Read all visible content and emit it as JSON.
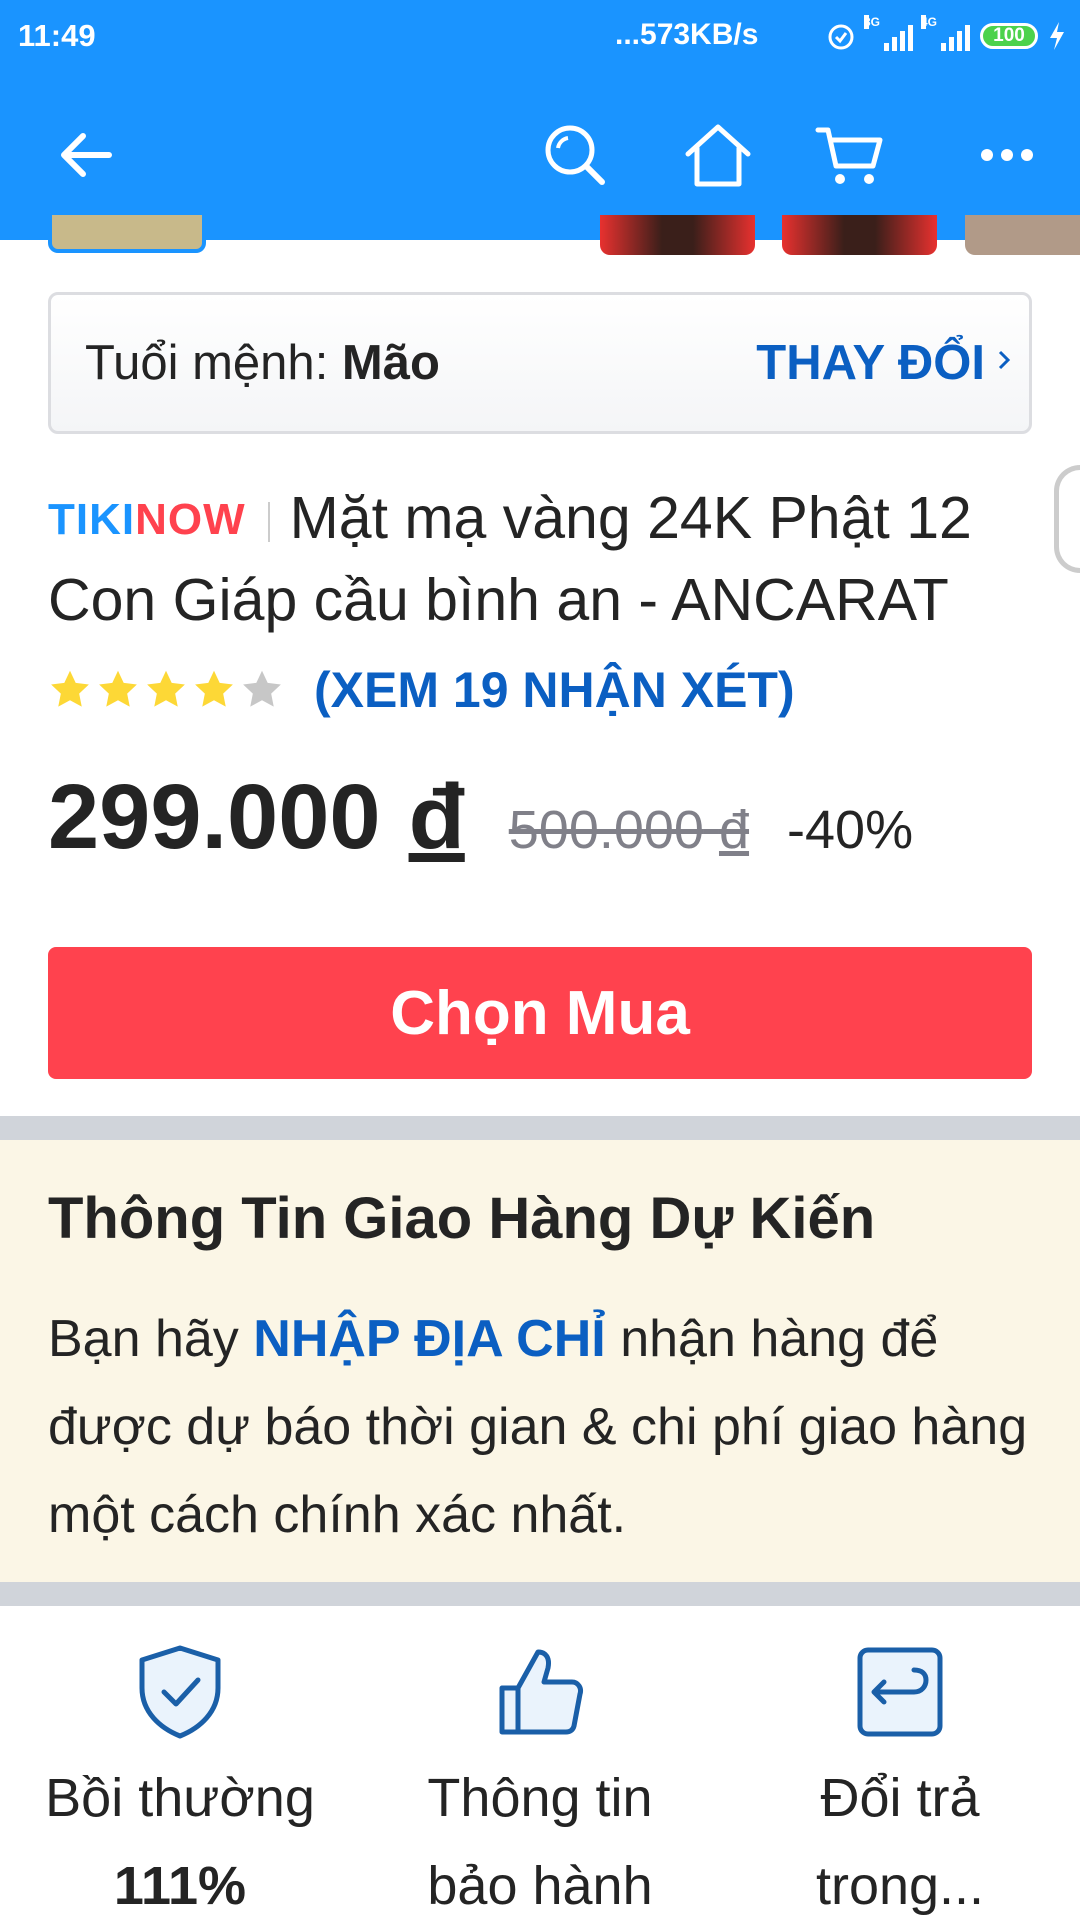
{
  "status_bar": {
    "time": "11:49",
    "network_speed": "...573KB/s",
    "signal_1_label": "3G",
    "signal_2_label": "4G",
    "battery": "100"
  },
  "app_bar": {
    "back_icon": "arrow-left-icon",
    "search_icon": "search-icon",
    "home_icon": "home-icon",
    "cart_icon": "cart-icon",
    "more_icon": "more-dots-icon",
    "background_color": "#1a94ff"
  },
  "zodiac": {
    "label": "Tuổi mệnh: ",
    "value": "Mão",
    "change_label": "THAY ĐỔI"
  },
  "product": {
    "badge_part1": "TIKI",
    "badge_part2": "NOW",
    "title": "Mặt mạ vàng 24K Phật 12 Con Giáp cầu bình an - ANCARAT",
    "rating": 4,
    "rating_max": 5,
    "reviews_label": "(XEM 19 NHẬN XÉT)",
    "price": "299.000",
    "currency": "đ",
    "old_price": "500.000",
    "discount": "-40%",
    "buy_label": "Chọn Mua"
  },
  "delivery": {
    "title": "Thông Tin Giao Hàng Dự Kiến",
    "text_before": "Bạn hãy ",
    "link": "NHẬP ĐỊA CHỈ",
    "text_after": " nhận hàng để được dự báo thời gian & chi phí giao hàng một cách chính xác nhất."
  },
  "features": [
    {
      "icon": "shield-check-icon",
      "line1": "Bồi thường",
      "line2": "111%"
    },
    {
      "icon": "thumbs-up-icon",
      "line1": "Thông tin",
      "line2": "bảo hành"
    },
    {
      "icon": "return-icon",
      "line1": "Đổi trả",
      "line2": "trong..."
    }
  ],
  "colors": {
    "primary": "#1a94ff",
    "link": "#0b5fc2",
    "buy": "#ff424e",
    "star": "#fdd836",
    "delivery_bg": "#fbf6e6"
  }
}
